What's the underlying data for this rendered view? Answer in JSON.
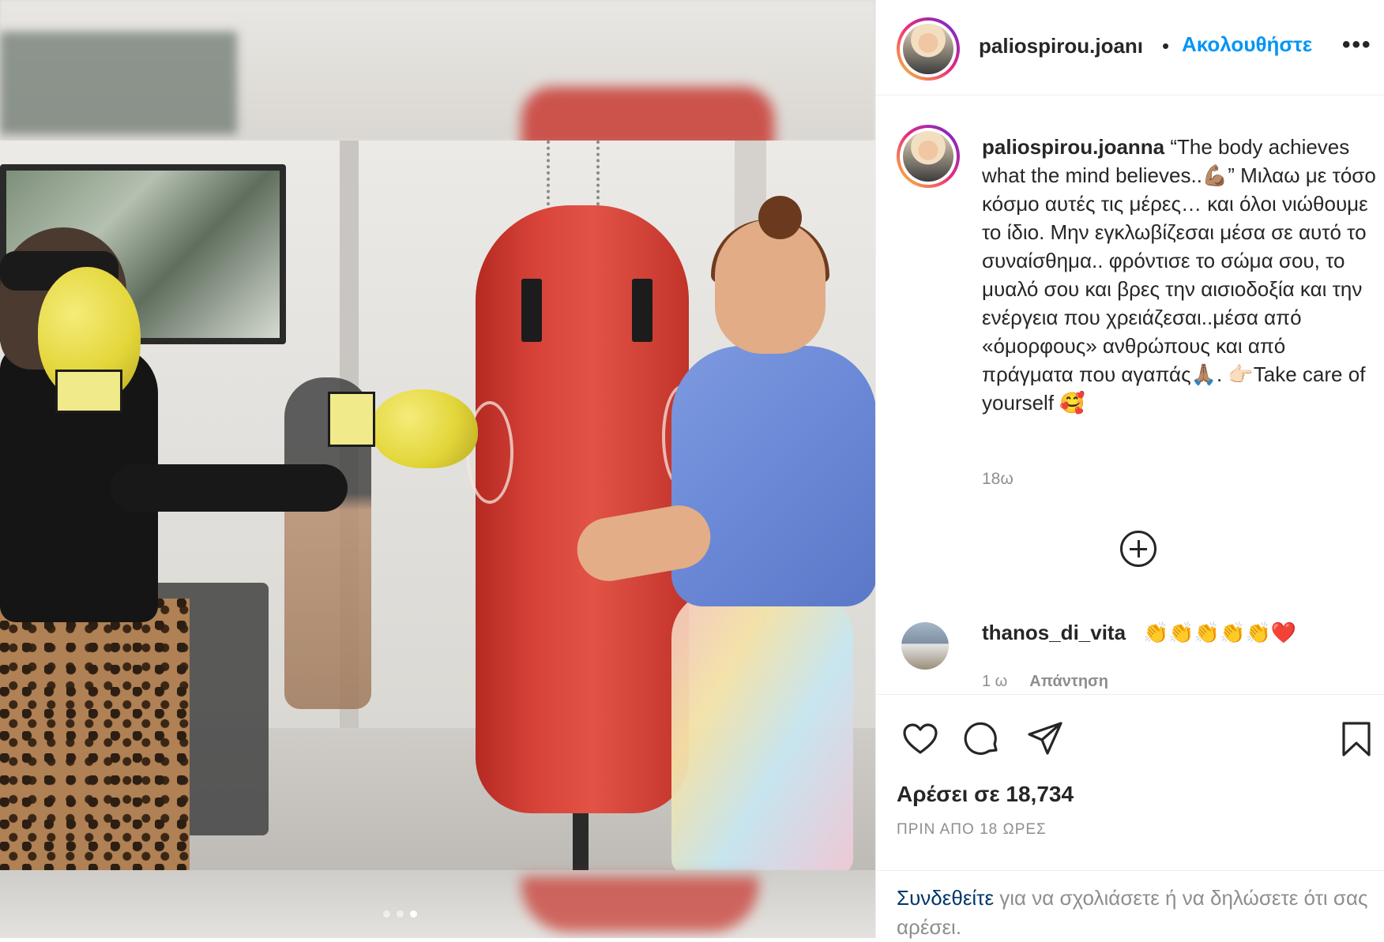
{
  "post": {
    "author": "paliospirou.joanna",
    "author_truncated": "paliospirou.joanı",
    "separator": "•",
    "follow_label": "Ακολουθήστε",
    "more_label": "•••",
    "caption": {
      "username": "paliospirou.joanna",
      "text": " “The body achieves what the mind believes..💪🏽” Μιλαω με τόσο κόσμο αυτές τις μέρες… και όλοι νιώθουμε το ίδιο. Μην εγκλωβίζεσαι μέσα σε αυτό το συναίσθημα.. φρόντισε το σώμα σου, το μυαλό σου και βρες την αισιοδοξία και την ενέργεια που χρειάζεσαι..μέσα από «όμορφους» ανθρώπους και από πράγματα που αγαπάς🙏🏽. 👉🏻Take care of yourself 🥰",
      "time": "18ω"
    },
    "load_more_icon": "plus-circle-icon",
    "comments": [
      {
        "username": "thanos_di_vita",
        "text": "👏👏👏👏👏❤️",
        "time": "1 ω",
        "reply_label": "Απάντηση"
      }
    ],
    "likes": "Αρέσει σε 18,734",
    "posted_ago": "ΠΡΙΝ ΑΠΟ 18 ΩΡΕΣ",
    "login_link": "Συνδεθείτε",
    "login_text": " για να σχολιάσετε ή να δηλώσετε ότι σας αρέσει.",
    "carousel": {
      "count": 3,
      "active_index": 2
    }
  },
  "colors": {
    "accent": "#0095f6",
    "text": "#262626",
    "muted": "#8e8e8e",
    "link": "#00376b",
    "border": "#efefef"
  },
  "icons": [
    "like-icon",
    "comment-icon",
    "share-icon",
    "save-icon",
    "plus-circle-icon",
    "more-options-icon"
  ]
}
